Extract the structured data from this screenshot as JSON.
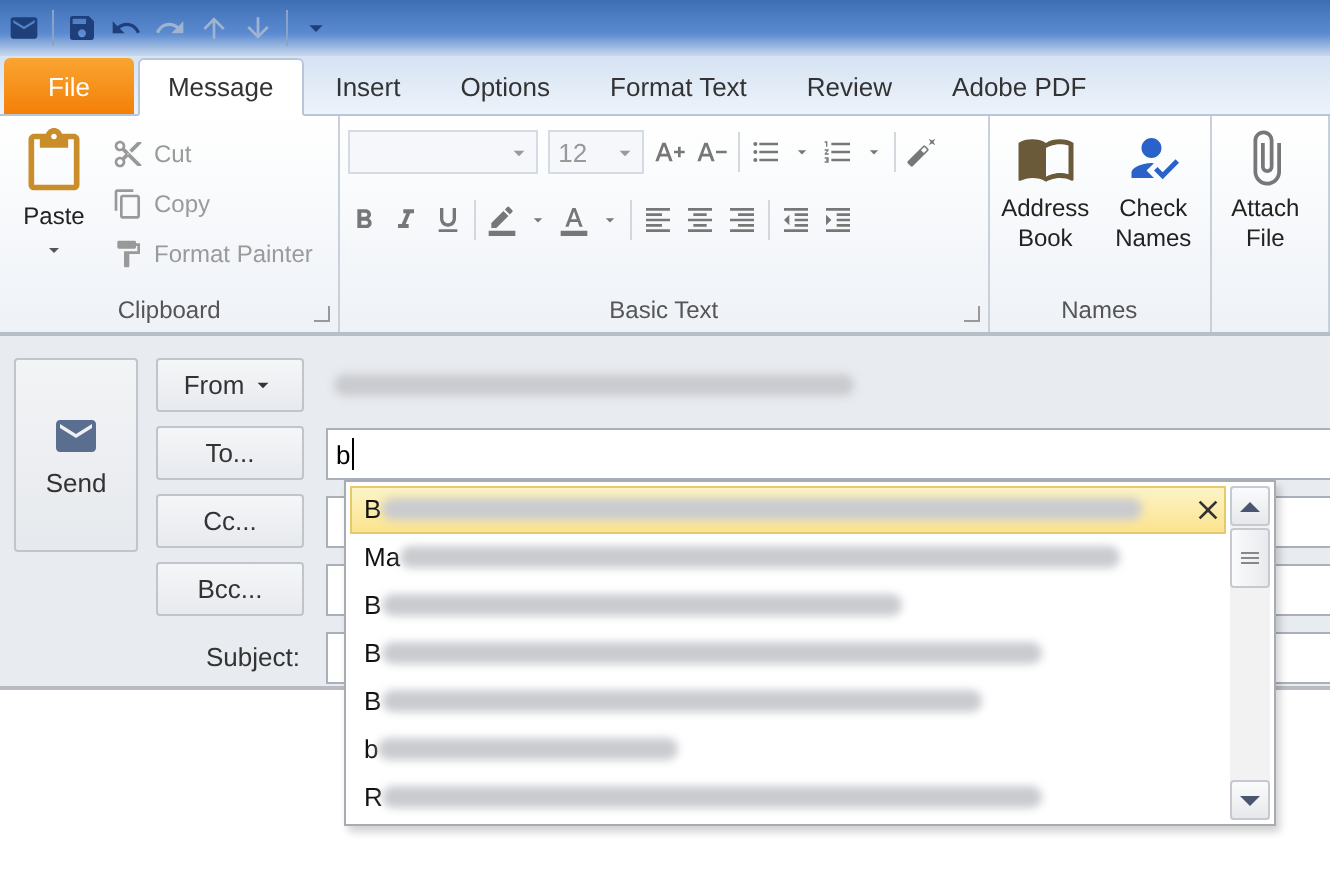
{
  "tabs": [
    {
      "label": "File",
      "kind": "file",
      "selected": false
    },
    {
      "label": "Message",
      "kind": "tab",
      "selected": true
    },
    {
      "label": "Insert",
      "kind": "tab",
      "selected": false
    },
    {
      "label": "Options",
      "kind": "tab",
      "selected": false
    },
    {
      "label": "Format Text",
      "kind": "tab",
      "selected": false
    },
    {
      "label": "Review",
      "kind": "tab",
      "selected": false
    },
    {
      "label": "Adobe PDF",
      "kind": "tab",
      "selected": false
    }
  ],
  "clipboard": {
    "label": "Clipboard",
    "paste": "Paste",
    "commands": [
      {
        "label": "Cut",
        "kind": "cut",
        "disabled": true
      },
      {
        "label": "Copy",
        "kind": "copy",
        "disabled": true
      },
      {
        "label": "Format Painter",
        "kind": "painter",
        "disabled": true
      }
    ]
  },
  "basic_text": {
    "label": "Basic Text",
    "font_size": "12"
  },
  "names": {
    "label": "Names",
    "buttons": [
      {
        "label": "Address Book",
        "kind": "book"
      },
      {
        "label": "Check Names",
        "kind": "check"
      }
    ]
  },
  "attach": {
    "label": "Attach File"
  },
  "send": {
    "label": "Send"
  },
  "fields": [
    {
      "button": "From",
      "kind": "from",
      "redacted": true
    },
    {
      "button": "To...",
      "kind": "recipient",
      "value": "b"
    },
    {
      "button": "Cc...",
      "kind": "recipient"
    },
    {
      "button": "Bcc...",
      "kind": "recipient"
    },
    {
      "button": "Subject:",
      "kind": "label"
    }
  ],
  "suggestions": [
    {
      "text": "B",
      "selected": true
    },
    {
      "text": "Ma",
      "selected": false
    },
    {
      "text": "B",
      "selected": false
    },
    {
      "text": "B",
      "selected": false
    },
    {
      "text": "B",
      "selected": false
    },
    {
      "text": "b",
      "selected": false
    },
    {
      "text": "R",
      "selected": false
    }
  ]
}
